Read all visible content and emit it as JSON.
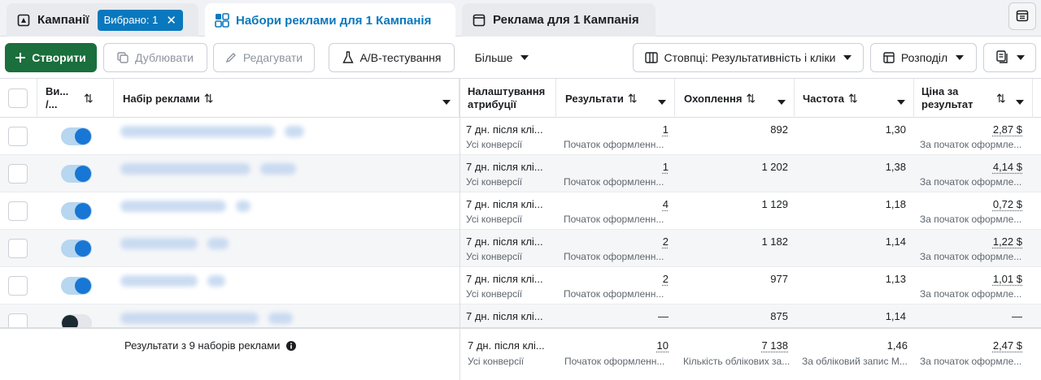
{
  "tabs": {
    "campaigns": {
      "label": "Кампанії",
      "selected": "Вибрано: 1"
    },
    "adsets": {
      "label": "Набори реклами для 1 Кампанія"
    },
    "ads": {
      "label": "Реклама для 1 Кампанія"
    }
  },
  "toolbar": {
    "create": "Створити",
    "duplicate": "Дублювати",
    "edit": "Редагувати",
    "ab_test": "A/B-тестування",
    "more": "Більше",
    "columns": "Стовпці: Результативність і кліки",
    "breakdown": "Розподіл"
  },
  "table": {
    "headers": {
      "onoff": "Ви... /...",
      "adset": "Набір реклами",
      "attribution": "Налаштування атрибуції",
      "results": "Результати",
      "reach": "Охоплення",
      "frequency": "Частота",
      "cost": "Ціна за результат"
    },
    "rows": [
      {
        "on": true,
        "attribution": "7 дн. після клі...",
        "attribution_sub": "Усі конверсії",
        "results": "1",
        "results_sub": "Початок оформленн...",
        "reach": "892",
        "frequency": "1,30",
        "cost": "2,87 $",
        "cost_sub": "За початок оформле..."
      },
      {
        "on": true,
        "attribution": "7 дн. після клі...",
        "attribution_sub": "Усі конверсії",
        "results": "1",
        "results_sub": "Початок оформленн...",
        "reach": "1 202",
        "frequency": "1,38",
        "cost": "4,14 $",
        "cost_sub": "За початок оформле..."
      },
      {
        "on": true,
        "attribution": "7 дн. після клі...",
        "attribution_sub": "Усі конверсії",
        "results": "4",
        "results_sub": "Початок оформленн...",
        "reach": "1 129",
        "frequency": "1,18",
        "cost": "0,72 $",
        "cost_sub": "За початок оформле..."
      },
      {
        "on": true,
        "attribution": "7 дн. після клі...",
        "attribution_sub": "Усі конверсії",
        "results": "2",
        "results_sub": "Початок оформленн...",
        "reach": "1 182",
        "frequency": "1,14",
        "cost": "1,22 $",
        "cost_sub": "За початок оформле..."
      },
      {
        "on": true,
        "attribution": "7 дн. після клі...",
        "attribution_sub": "Усі конверсії",
        "results": "2",
        "results_sub": "Початок оформленн...",
        "reach": "977",
        "frequency": "1,13",
        "cost": "1,01 $",
        "cost_sub": "За початок оформле..."
      },
      {
        "on": false,
        "attribution": "7 дн. після клі...",
        "attribution_sub": "",
        "results": "—",
        "results_sub": "",
        "reach": "875",
        "frequency": "1,14",
        "cost": "—",
        "cost_sub": ""
      }
    ],
    "footer": {
      "summary": "Результати з 9 наборів реклами",
      "attribution": "7 дн. після клі...",
      "attribution_sub": "Усі конверсії",
      "results": "10",
      "results_sub": "Початок оформленн...",
      "reach": "7 138",
      "reach_sub": "Кількість облікових за...",
      "frequency": "1,46",
      "frequency_sub": "За обліковий запис М...",
      "cost": "2,47 $",
      "cost_sub": "За початок оформле..."
    }
  },
  "colors": {
    "accent": "#0a78be",
    "create": "#1a6f3c",
    "toggle_on": "#1877d4"
  }
}
